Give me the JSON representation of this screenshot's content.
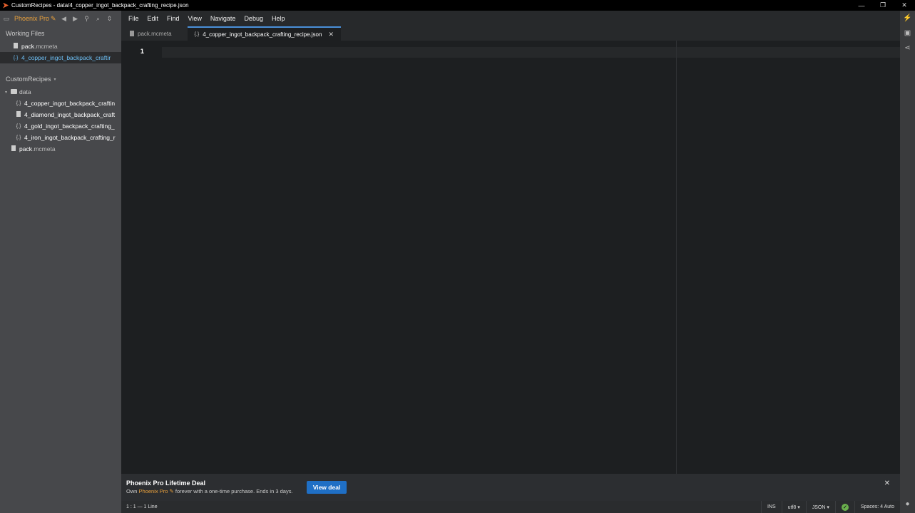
{
  "window": {
    "title": "CustomRecipes - data/4_copper_ingot_backpack_crafting_recipe.json",
    "controls": {
      "minimize": "—",
      "maximize": "❐",
      "close": "✕"
    }
  },
  "sidebar": {
    "brand": "Phoenix Pro",
    "brand_icon": "✎",
    "toolbar_icons": [
      "back-icon",
      "forward-icon",
      "binoculars-icon",
      "search-icon",
      "sort-icon"
    ],
    "toolbar_glyphs": {
      "back": "◀",
      "forward": "▶",
      "find": "⚲",
      "search": "⌕",
      "sort": "⇕"
    },
    "working_files_title": "Working Files",
    "working_files": [
      {
        "name": "pack",
        "ext": ".mcmeta",
        "icon": "document-icon",
        "selected": false
      },
      {
        "name": "4_copper_ingot_backpack_craftir",
        "ext": "",
        "icon": "json-icon",
        "selected": true
      }
    ],
    "project_title": "CustomRecipes",
    "project_caret": "▾",
    "tree": {
      "folder": "data",
      "folder_caret": "▾",
      "files": [
        {
          "name": "4_copper_ingot_backpack_craftin",
          "icon": "json-icon"
        },
        {
          "name": "4_diamond_ingot_backpack_craft",
          "icon": "document-icon"
        },
        {
          "name": "4_gold_ingot_backpack_crafting_",
          "icon": "json-icon"
        },
        {
          "name": "4_iron_ingot_backpack_crafting_r",
          "icon": "json-icon"
        }
      ],
      "root_file": {
        "name": "pack",
        "ext": ".mcmeta"
      }
    }
  },
  "menu": [
    "File",
    "Edit",
    "Find",
    "View",
    "Navigate",
    "Debug",
    "Help"
  ],
  "tabs": [
    {
      "label": "pack.mcmeta",
      "icon": "document-icon",
      "active": false
    },
    {
      "label": "4_copper_ingot_backpack_crafting_recipe.json",
      "icon": "json-icon",
      "active": true,
      "close": "✕"
    }
  ],
  "editor": {
    "line_number": "1",
    "json_glyph": "{.}"
  },
  "notification": {
    "title": "Phoenix Pro Lifetime Deal",
    "body_prefix": "Own",
    "body_brand": "Phoenix Pro",
    "body_suffix": "forever with a one-time purchase. Ends in 3 days.",
    "button": "View deal",
    "close": "✕"
  },
  "status": {
    "cursor": "1 : 1 — 1 Line",
    "mode": "INS",
    "encoding": "utf8 ▾",
    "language": "JSON ▾",
    "lint_ok": "✓",
    "indent": "Spaces: 4  Auto"
  },
  "right_toolbar": {
    "icons": [
      "live-preview-icon",
      "extension-manager-icon",
      "share-icon",
      "account-icon"
    ],
    "glyphs": {
      "live": "⚡",
      "extensions": "▣",
      "share": "⋖",
      "account": "●"
    }
  }
}
